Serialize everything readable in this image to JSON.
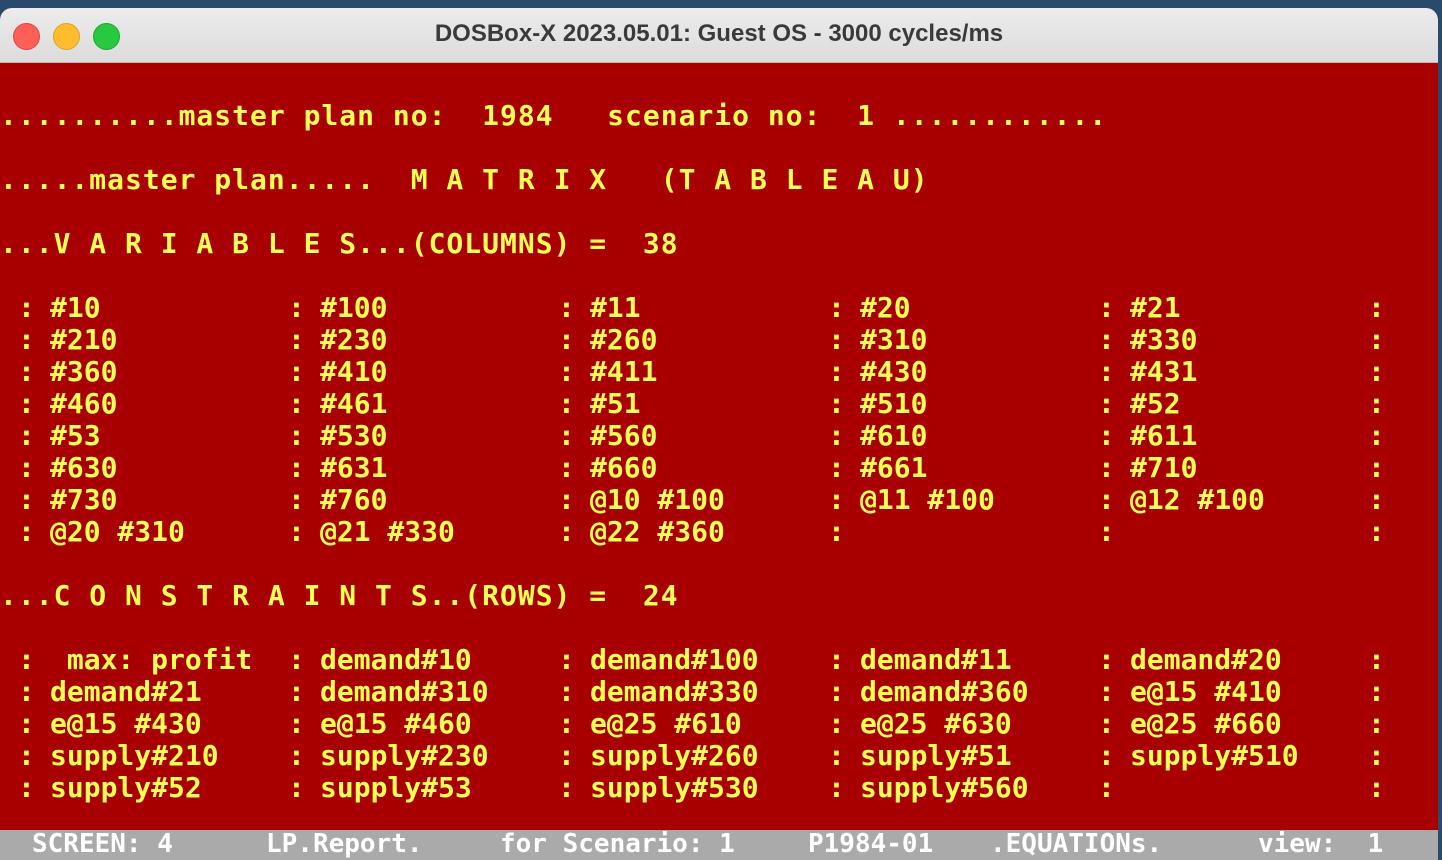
{
  "window": {
    "title": "DOSBox-X 2023.05.01: Guest OS - 3000 cycles/ms"
  },
  "header": {
    "line1": "..........master plan no:  1984   scenario no:  1 ............",
    "line2": ".....master plan.....  M A T R I X   (T A B L E A U)",
    "variables_line": "...V A R I A B L E S...(COLUMNS) =  38",
    "constraints_line": "...C O N S T R A I N T S..(ROWS) =  24"
  },
  "variables": [
    [
      "#10",
      "#100",
      "#11",
      "#20",
      "#21"
    ],
    [
      "#210",
      "#230",
      "#260",
      "#310",
      "#330"
    ],
    [
      "#360",
      "#410",
      "#411",
      "#430",
      "#431"
    ],
    [
      "#460",
      "#461",
      "#51",
      "#510",
      "#52"
    ],
    [
      "#53",
      "#530",
      "#560",
      "#610",
      "#611"
    ],
    [
      "#630",
      "#631",
      "#660",
      "#661",
      "#710"
    ],
    [
      "#730",
      "#760",
      "@10 #100",
      "@11 #100",
      "@12 #100"
    ],
    [
      "@20 #310",
      "@21 #330",
      "@22 #360",
      "",
      ""
    ]
  ],
  "constraints": [
    [
      " max: profit",
      "demand#10",
      "demand#100",
      "demand#11",
      "demand#20"
    ],
    [
      "demand#21",
      "demand#310",
      "demand#330",
      "demand#360",
      "e@15 #410"
    ],
    [
      "e@15 #430",
      "e@15 #460",
      "e@25 #610",
      "e@25 #630",
      "e@25 #660"
    ],
    [
      "supply#210",
      "supply#230",
      "supply#260",
      "supply#51",
      "supply#510"
    ],
    [
      "supply#52",
      "supply#53",
      "supply#530",
      "supply#560",
      ""
    ]
  ],
  "statusbar": {
    "screen": "SCREEN: 4",
    "report": "LP.Report.",
    "scenario": "for Scenario: 1",
    "plan": "P1984-01",
    "equations": ".EQUATIONs.",
    "view": "view:  1"
  },
  "colors": {
    "background": "#a80000",
    "text": "#fffe55",
    "statusbar": "#aaaaaa"
  }
}
